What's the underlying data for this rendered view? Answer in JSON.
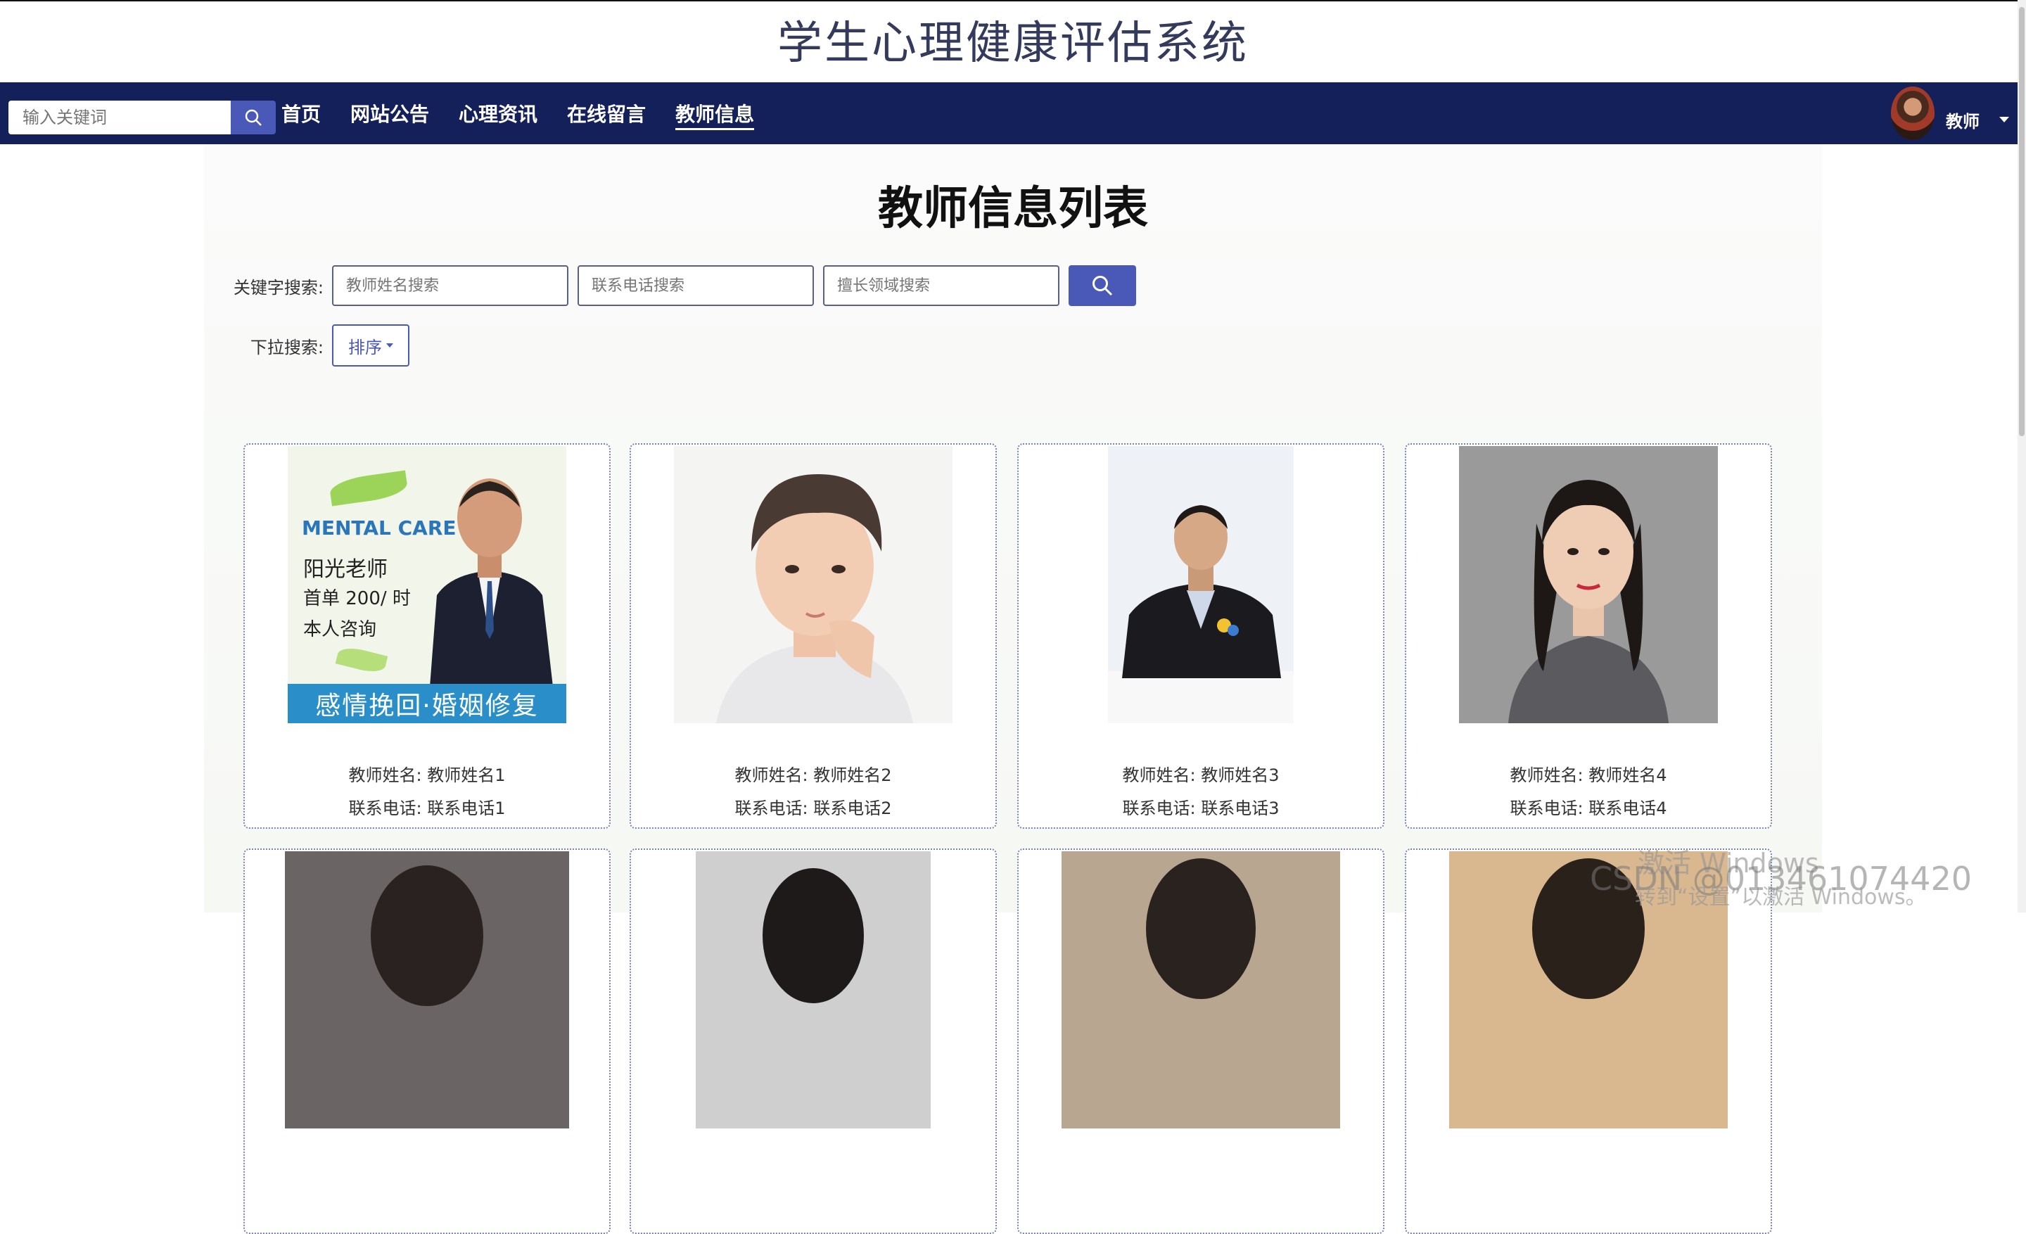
{
  "site": {
    "title": "学生心理健康评估系统"
  },
  "nav": {
    "search_placeholder": "输入关键词",
    "links": [
      "首页",
      "网站公告",
      "心理资讯",
      "在线留言",
      "教师信息"
    ],
    "active": "教师信息",
    "user_name": "教师"
  },
  "page": {
    "title": "教师信息列表",
    "keyword_label": "关键字搜索:",
    "placeholders": [
      "教师姓名搜索",
      "联系电话搜索",
      "擅长领域搜索"
    ],
    "dropdown_label": "下拉搜索:",
    "sort_label": "排序"
  },
  "cards": [
    {
      "name_line": "教师姓名: 教师姓名1",
      "phone_line": "联系电话: 联系电话1"
    },
    {
      "name_line": "教师姓名: 教师姓名2",
      "phone_line": "联系电话: 联系电话2"
    },
    {
      "name_line": "教师姓名: 教师姓名3",
      "phone_line": "联系电话: 联系电话3"
    },
    {
      "name_line": "教师姓名: 教师姓名4",
      "phone_line": "联系电话: 联系电话4"
    }
  ],
  "poster": {
    "brand": "MENTAL CARE",
    "line1": "阳光老师",
    "line2": "首单 200/ 时",
    "line3": "本人咨询",
    "banner": "感情挽回·婚姻修复"
  },
  "watermark": {
    "csdn": "CSDN @013461074420",
    "win1": "激活 Windows",
    "win2": "转到“设置”以激活 Windows。"
  },
  "colors": {
    "nav_bg": "#14205a",
    "accent": "#4a58b8"
  }
}
